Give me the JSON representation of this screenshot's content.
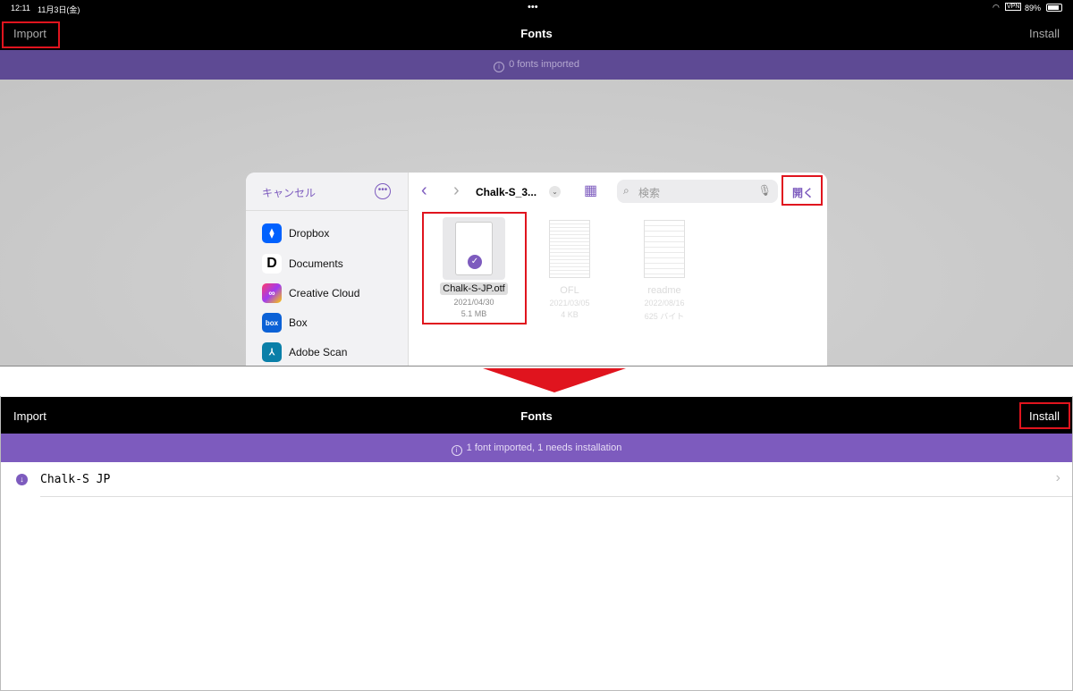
{
  "status_bar": {
    "time": "12:11",
    "date": "11月3日(金)",
    "dots": "•••",
    "vpn": "VPN",
    "battery": "89%"
  },
  "top": {
    "nav": {
      "import": "Import",
      "title": "Fonts",
      "install": "Install"
    },
    "banner": "0 fonts imported"
  },
  "picker": {
    "cancel": "キャンセル",
    "folder": "Chalk-S_3...",
    "search_placeholder": "検索",
    "open": "開く",
    "sidebar": [
      {
        "label": "Dropbox",
        "color": "#0061fe",
        "icon": "dropbox-icon",
        "glyph": "⧫"
      },
      {
        "label": "Documents",
        "color": "#ffffff",
        "icon": "documents-icon",
        "glyph": "D"
      },
      {
        "label": "Creative Cloud",
        "color": "#e8306b",
        "icon": "creative-cloud-icon",
        "glyph": "∞"
      },
      {
        "label": "Box",
        "color": "#0b61d6",
        "icon": "box-icon",
        "glyph": "box"
      },
      {
        "label": "Adobe Scan",
        "color": "#0a7fa8",
        "icon": "adobe-scan-icon",
        "glyph": "⅄"
      }
    ],
    "files": [
      {
        "name": "Chalk-S-JP.otf",
        "date": "2021/04/30",
        "size": "5.1 MB"
      },
      {
        "name": "OFL",
        "date": "2021/03/05",
        "size": "4 KB"
      },
      {
        "name": "readme",
        "date": "2022/08/16",
        "size": "625 バイト"
      }
    ]
  },
  "bottom": {
    "nav": {
      "import": "Import",
      "title": "Fonts",
      "install": "Install"
    },
    "banner": "1 font imported, 1 needs installation",
    "fonts": [
      {
        "name": "Chalk-S JP"
      }
    ]
  },
  "colors": {
    "purple_dark": "#5e4a94",
    "purple": "#7d5bbe",
    "red": "#e0141e"
  }
}
